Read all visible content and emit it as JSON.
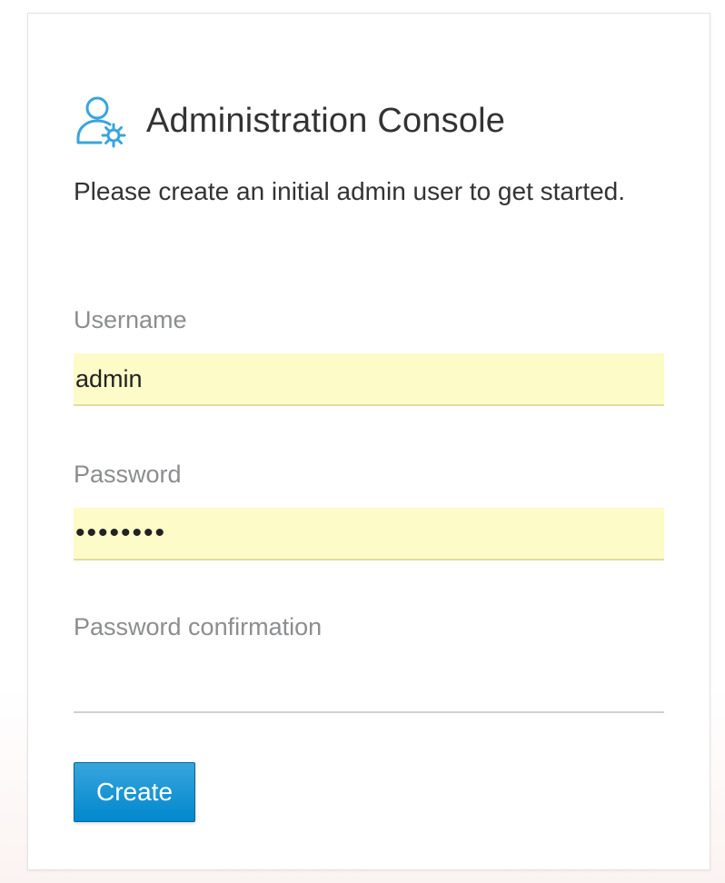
{
  "header": {
    "icon": "admin-user-gear-icon",
    "title": "Administration Console"
  },
  "form": {
    "subtitle": "Please create an initial admin user to get started.",
    "username": {
      "label": "Username",
      "value": "admin"
    },
    "password": {
      "label": "Password",
      "value": "password"
    },
    "password_confirmation": {
      "label": "Password confirmation",
      "value": ""
    },
    "submit_label": "Create"
  },
  "colors": {
    "accent": "#0088ce",
    "autofill_background": "#fdfbc7",
    "icon": "#39a5dc"
  }
}
